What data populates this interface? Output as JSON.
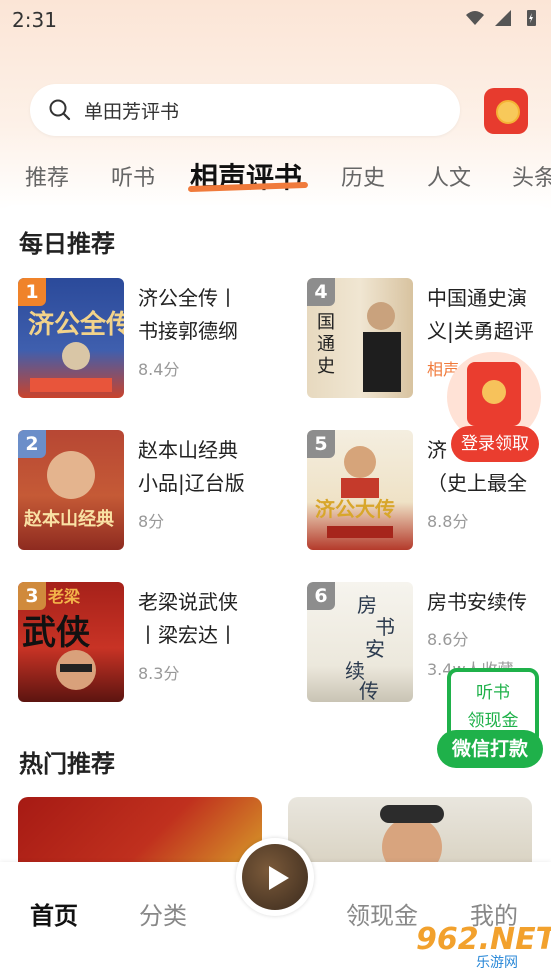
{
  "status": {
    "time": "2:31"
  },
  "search": {
    "text": "单田芳评书"
  },
  "tabs": [
    "推荐",
    "听书",
    "相声评书",
    "历史",
    "人文",
    "头条"
  ],
  "active_tab": "相声评书",
  "daily": {
    "title": "每日推荐",
    "books": [
      {
        "rank": "1",
        "title_line1": "济公全传丨",
        "title_line2": "书接郭德纲",
        "score": "8.4分",
        "rank_color": "#f0832a"
      },
      {
        "rank": "4",
        "title_line1": "中国通史演",
        "title_line2": "义|关勇超评",
        "score": "相声",
        "rank_color": "#8d8d8d"
      },
      {
        "rank": "2",
        "title_line1": "赵本山经典",
        "title_line2": "小品|辽台版",
        "score": "8分",
        "rank_color": "#6b8ec9"
      },
      {
        "rank": "5",
        "title_line1": "济",
        "title_line2": "（史上最全",
        "score": "8.8分",
        "rank_color": "#8d8d8d"
      },
      {
        "rank": "3",
        "title_line1": "老梁说武侠",
        "title_line2": "丨梁宏达丨",
        "score": "8.3分",
        "rank_color": "#d08a3c"
      },
      {
        "rank": "6",
        "title_line1": "房书安续传",
        "title_line2": "",
        "score": "8.6分",
        "extra": "3.4w人收藏",
        "rank_color": "#8d8d8d"
      }
    ]
  },
  "hot": {
    "title": "热门推荐"
  },
  "float_red": {
    "label": "登录领取"
  },
  "float_green": {
    "line1": "听书",
    "line2": "领现金",
    "button": "微信打款"
  },
  "bottom_nav": {
    "home": "首页",
    "category": "分类",
    "cash": "领现金",
    "mine": "我的"
  },
  "watermark": {
    "main": "962.NET",
    "sub": "乐游网"
  },
  "colors": {
    "accent": "#f07a3b",
    "red": "#ea3d2f",
    "green": "#1fb14a"
  }
}
